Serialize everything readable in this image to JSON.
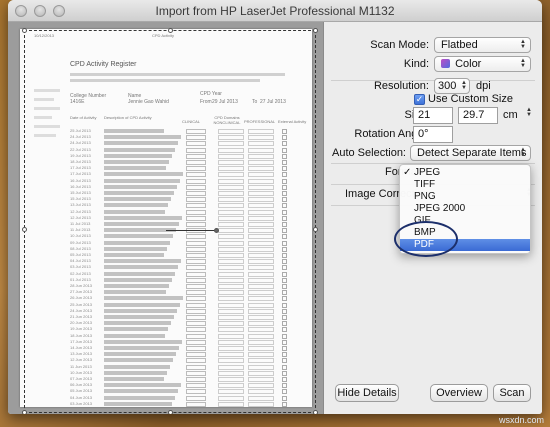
{
  "window": {
    "title": "Import from HP LaserJet Professional M1132"
  },
  "document": {
    "header_id": "10/12/2013",
    "header_center": "CPD Activity",
    "title": "CPD Activity Register",
    "college_number_label": "College Number",
    "college_number": "1416E",
    "name_label": "Name",
    "name_value": "Jennie Gao Wahid",
    "cpd_year_label": "CPD Year",
    "from_label": "From",
    "from_date": "29 Jul 2013",
    "to_label": "To",
    "to_date": "27 Jul 2013",
    "columns": [
      "Date of Activity",
      "Description of CPD Activity",
      "CLINICAL",
      "CPD Domains NONCLINICAL",
      "PROFESSIONAL",
      "External Activity"
    ],
    "dates": [
      "25 Jul 2013",
      "24 Jul 2013",
      "24 Jul 2013",
      "22 Jul 2013",
      "19 Jul 2013",
      "18 Jul 2013",
      "17 Jul 2013",
      "17 Jul 2013",
      "16 Jul 2013",
      "16 Jul 2013",
      "15 Jul 2013",
      "15 Jul 2013",
      "13 Jul 2013",
      "12 Jul 2013",
      "12 Jul 2013",
      "11 Jul 2013",
      "11 Jul 2013",
      "10 Jul 2013",
      "09 Jul 2013",
      "08 Jul 2013",
      "05 Jul 2013",
      "04 Jul 2013",
      "03 Jul 2013",
      "02 Jul 2013",
      "01 Jul 2013",
      "28 Jun 2013",
      "27 Jun 2013",
      "26 Jun 2013",
      "25 Jun 2013",
      "24 Jun 2013",
      "21 Jun 2013",
      "20 Jun 2013",
      "19 Jun 2013",
      "18 Jun 2013",
      "17 Jun 2013",
      "14 Jun 2013",
      "13 Jun 2013",
      "12 Jun 2013",
      "11 Jun 2013",
      "10 Jun 2013",
      "07 Jun 2013",
      "06 Jun 2013",
      "05 Jun 2013",
      "04 Jun 2013",
      "03 Jun 2013"
    ]
  },
  "panel": {
    "scan_mode": {
      "label": "Scan Mode:",
      "value": "Flatbed"
    },
    "kind": {
      "label": "Kind:",
      "value": "Color"
    },
    "resolution": {
      "label": "Resolution:",
      "value": "300",
      "unit": "dpi"
    },
    "custom_size": {
      "label": "Use Custom Size",
      "checked": true,
      "check_mark": "✓"
    },
    "size": {
      "label": "Size:",
      "width": "21",
      "height": "29.7",
      "unit": "cm"
    },
    "rotation": {
      "label": "Rotation Angle:",
      "value": "0°"
    },
    "auto_selection": {
      "label": "Auto Selection:",
      "value": "Detect Separate Items"
    },
    "format": {
      "label": "Format"
    },
    "image_correction": {
      "label": "Image Correction"
    },
    "format_menu": {
      "check": "✓",
      "items": [
        "JPEG",
        "TIFF",
        "PNG",
        "JPEG 2000",
        "GIF",
        "BMP",
        "PDF"
      ],
      "checked_index": 0,
      "highlighted_index": 6
    },
    "buttons": {
      "hide_details": "Hide Details",
      "overview": "Overview",
      "scan": "Scan"
    }
  },
  "watermark": "wsxdn.com",
  "colors": {
    "highlight": "#3a6ad4",
    "annotation_circle": "#1c2f6b"
  }
}
